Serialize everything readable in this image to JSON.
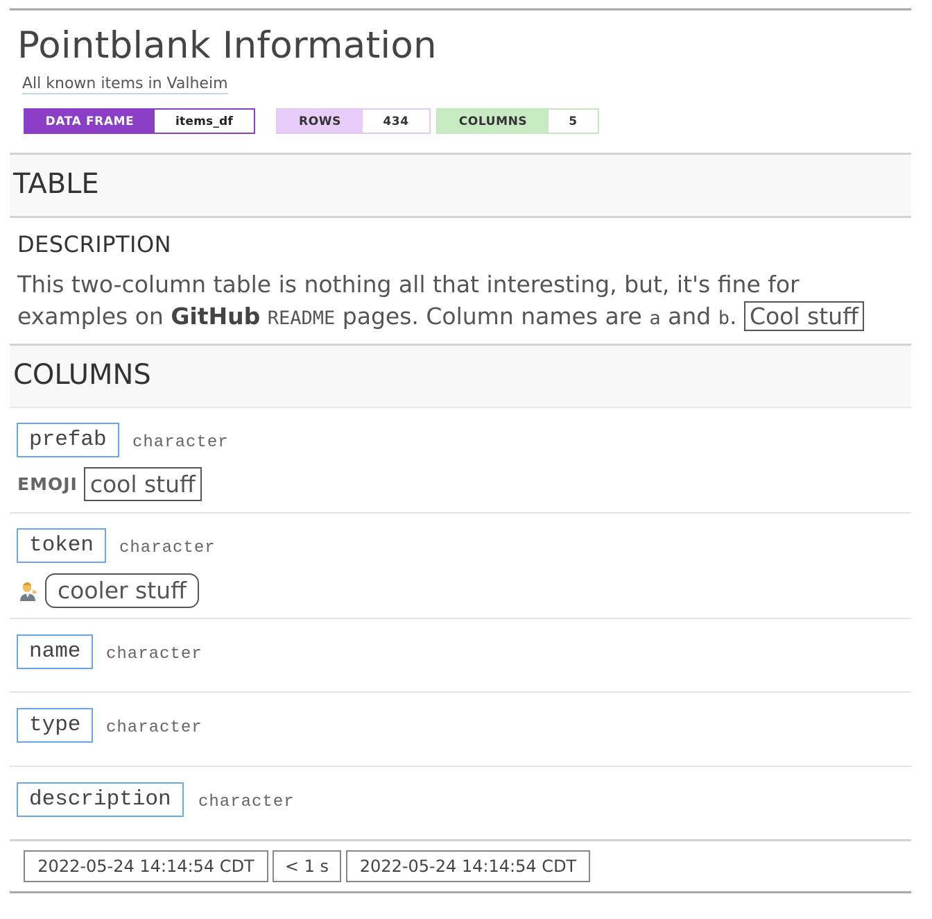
{
  "header": {
    "title": "Pointblank Information",
    "subtitle": "All known items in Valheim"
  },
  "badges": {
    "data_frame": {
      "label": "DATA FRAME",
      "value": "items_df"
    },
    "rows": {
      "label": "ROWS",
      "value": "434"
    },
    "columns": {
      "label": "COLUMNS",
      "value": "5"
    }
  },
  "table_section": {
    "heading": "TABLE",
    "description_label": "DESCRIPTION",
    "description": {
      "part1": "This two-column table is nothing all that interesting, but, it's fine for examples on ",
      "github": "GitHub",
      "space1": " ",
      "readme": "README",
      "part2": " pages. Column names are ",
      "col_a": "a",
      "and": " and ",
      "col_b": "b",
      "period": ". ",
      "boxed": "Cool stuff"
    }
  },
  "columns_section": {
    "heading": "COLUMNS",
    "columns": [
      {
        "name": "prefab",
        "type": "character",
        "label_tag": "EMOJI",
        "label_text": "cool stuff"
      },
      {
        "name": "token",
        "type": "character",
        "label_icon": "person-tipping-hand-icon",
        "label_text": "cooler stuff"
      },
      {
        "name": "name",
        "type": "character"
      },
      {
        "name": "type",
        "type": "character"
      },
      {
        "name": "description",
        "type": "character"
      }
    ]
  },
  "footer": {
    "start_time": "2022-05-24 14:14:54 CDT",
    "duration": "< 1 s",
    "end_time": "2022-05-24 14:14:54 CDT"
  },
  "colors": {
    "data_frame_accent": "#8b3fc6",
    "rows_accent": "#e8cdf8",
    "columns_accent": "#c8eac2",
    "column_name_border": "#6aa7e8"
  }
}
